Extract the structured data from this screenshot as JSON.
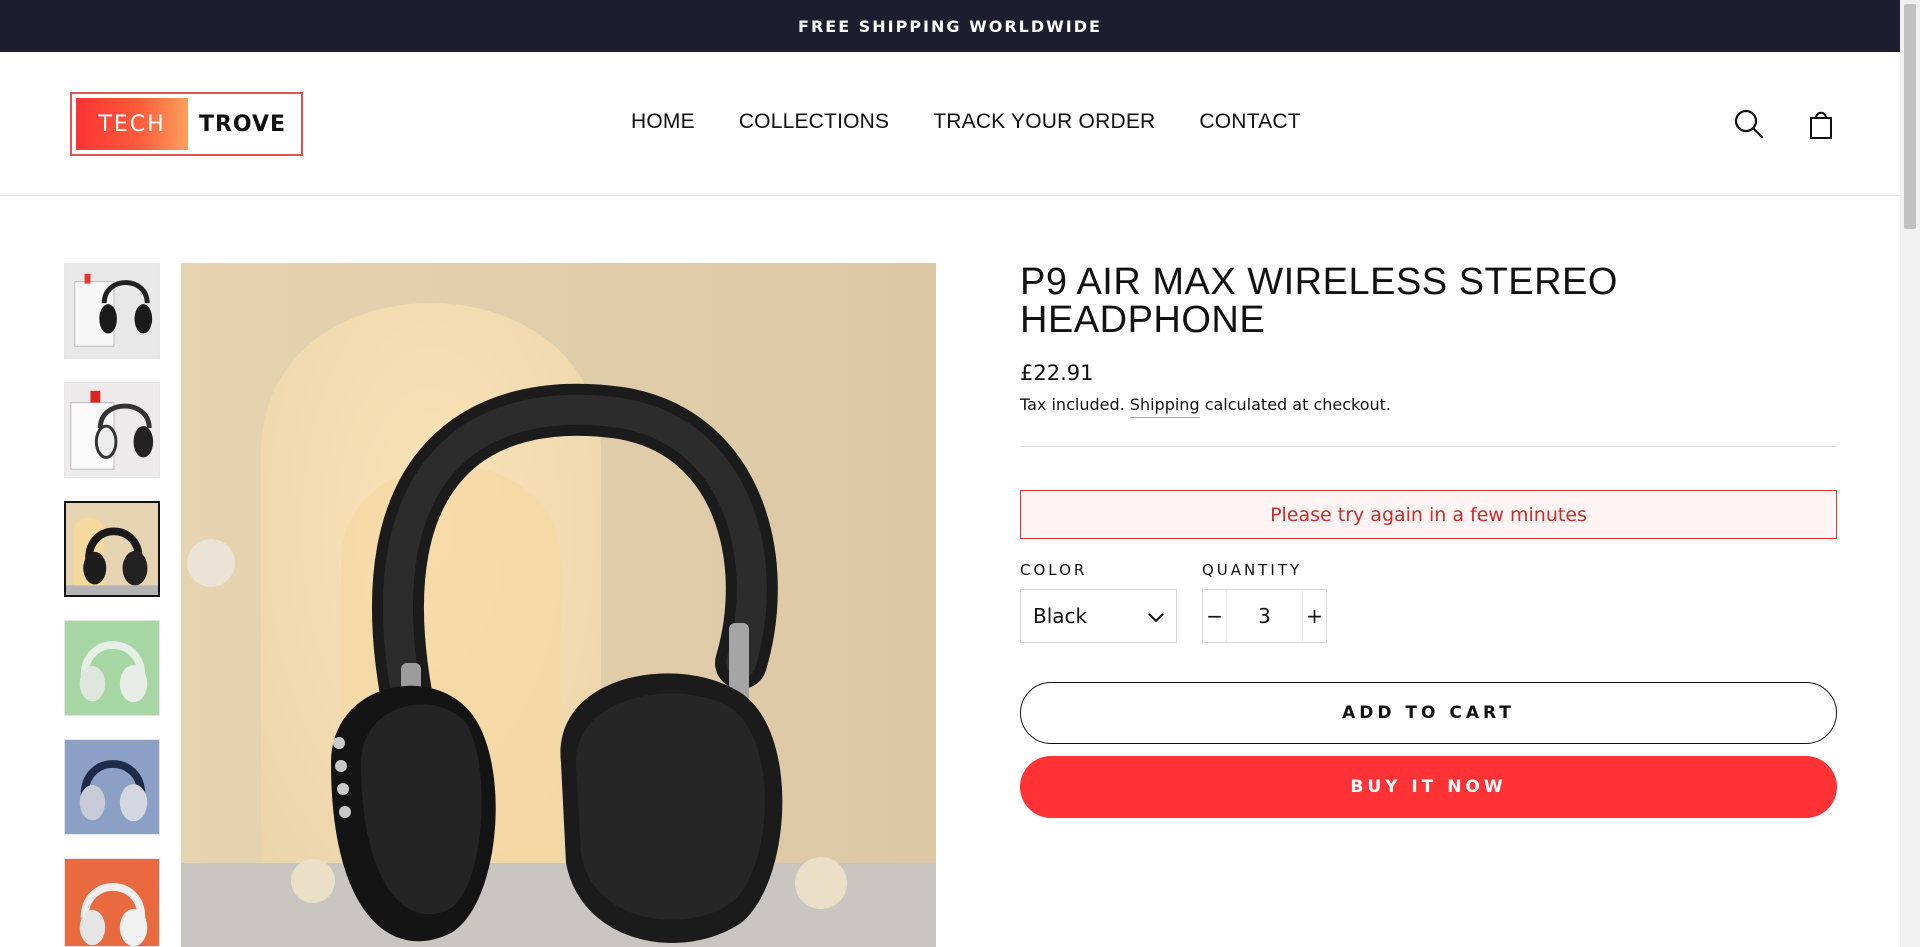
{
  "announcement": {
    "text": "FREE SHIPPING WORLDWIDE"
  },
  "logo": {
    "left_text": "TECH",
    "right_text": "TROVE"
  },
  "nav": {
    "items": [
      {
        "label": "HOME"
      },
      {
        "label": "COLLECTIONS"
      },
      {
        "label": "TRACK YOUR ORDER"
      },
      {
        "label": "CONTACT"
      }
    ]
  },
  "header_icons": [
    "search-icon",
    "cart-icon"
  ],
  "gallery": {
    "thumbnails": [
      {
        "name": "thumb-black-box",
        "background": "#e8e8e8",
        "active": false
      },
      {
        "name": "thumb-white-box",
        "background": "#eceaea",
        "active": false
      },
      {
        "name": "thumb-beige-scene",
        "background": "#e5d3b1",
        "active": true
      },
      {
        "name": "thumb-green",
        "background": "#a6d6a4",
        "active": false
      },
      {
        "name": "thumb-blue",
        "background": "#8ba0c4",
        "active": false
      },
      {
        "name": "thumb-orange",
        "background": "#e96a3e",
        "active": false
      }
    ]
  },
  "product": {
    "title": "P9 AIR MAX WIRELESS STEREO HEADPHONE",
    "price": "£22.91",
    "tax_prefix": "Tax included.",
    "shipping_link": "Shipping",
    "tax_suffix": "calculated at checkout.",
    "error_message": "Please try again in a few minutes",
    "color_label": "COLOR",
    "color_value": "Black",
    "quantity_label": "QUANTITY",
    "quantity_value": "3",
    "qty_minus": "−",
    "qty_plus": "+",
    "add_to_cart": "ADD TO CART",
    "buy_now": "BUY IT NOW"
  },
  "colors": {
    "announcement_bg": "#1c1d2e",
    "buy_button": "#ff3235",
    "error_text": "#d02b2b",
    "logo_gradient_start": "#fc3335",
    "logo_gradient_end": "#fda05e"
  }
}
